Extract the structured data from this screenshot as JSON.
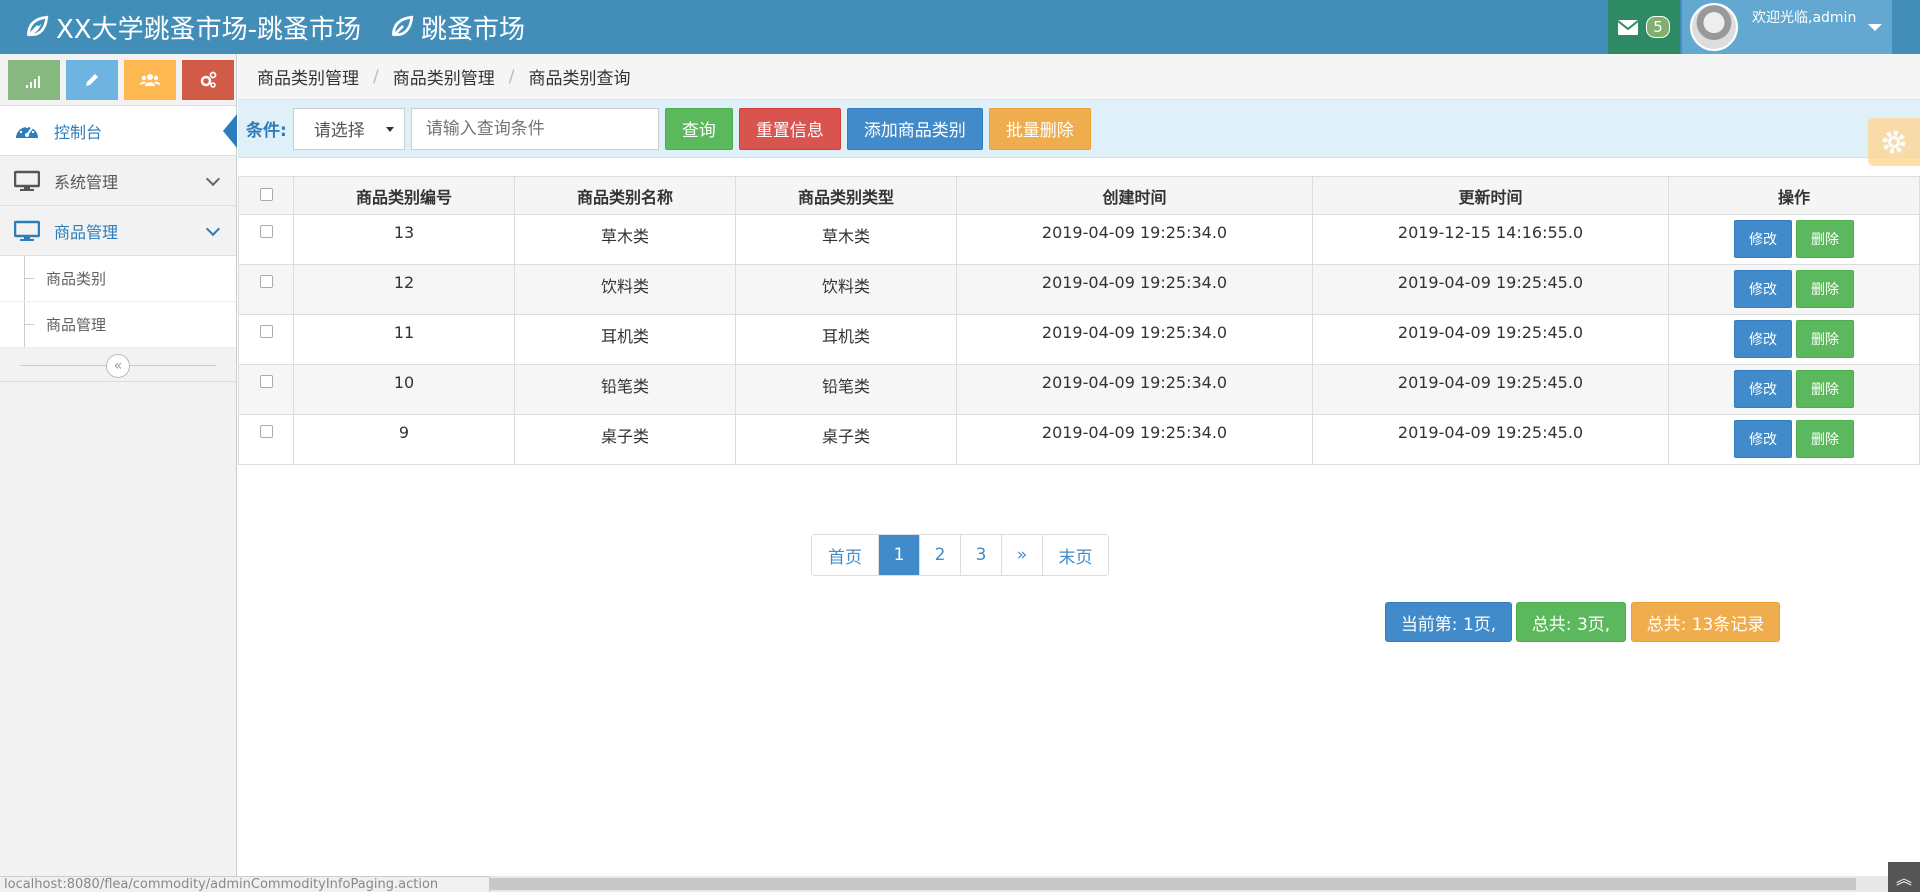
{
  "header": {
    "brand_title": "XX大学跳蚤市场-跳蚤市场",
    "brand_sub": "跳蚤市场",
    "message_count": "5",
    "welcome": "欢迎光临,admin",
    "accent": "#438eb9"
  },
  "sidebar": {
    "shortcuts": [
      {
        "icon": "signal-icon",
        "color": "#87b87f"
      },
      {
        "icon": "pencil-icon",
        "color": "#6fb3e0"
      },
      {
        "icon": "group-icon",
        "color": "#ffb752"
      },
      {
        "icon": "cogs-icon",
        "color": "#d15b47"
      }
    ],
    "items": [
      {
        "label": "控制台",
        "icon": "dashboard-icon"
      },
      {
        "label": "系统管理",
        "icon": "desktop-icon"
      },
      {
        "label": "商品管理",
        "icon": "desktop-icon"
      }
    ],
    "subitems": [
      {
        "label": "商品类别"
      },
      {
        "label": "商品管理"
      }
    ],
    "collapse_glyph": "«"
  },
  "breadcrumb": [
    "商品类别管理",
    "商品类别管理",
    "商品类别查询"
  ],
  "toolbar": {
    "condition_label": "条件:",
    "select_value": "请选择",
    "search_placeholder": "请输入查询条件",
    "query_label": "查询",
    "reset_label": "重置信息",
    "add_label": "添加商品类别",
    "batch_delete_label": "批量删除"
  },
  "table": {
    "headers": [
      "商品类别编号",
      "商品类别名称",
      "商品类别类型",
      "创建时间",
      "更新时间",
      "操作"
    ],
    "rows": [
      {
        "id": "13",
        "name": "草木类",
        "type": "草木类",
        "created": "2019-04-09 19:25:34.0",
        "updated": "2019-12-15 14:16:55.0"
      },
      {
        "id": "12",
        "name": "饮料类",
        "type": "饮料类",
        "created": "2019-04-09 19:25:34.0",
        "updated": "2019-04-09 19:25:45.0"
      },
      {
        "id": "11",
        "name": "耳机类",
        "type": "耳机类",
        "created": "2019-04-09 19:25:34.0",
        "updated": "2019-04-09 19:25:45.0"
      },
      {
        "id": "10",
        "name": "铅笔类",
        "type": "铅笔类",
        "created": "2019-04-09 19:25:34.0",
        "updated": "2019-04-09 19:25:45.0"
      },
      {
        "id": "9",
        "name": "桌子类",
        "type": "桌子类",
        "created": "2019-04-09 19:25:34.0",
        "updated": "2019-04-09 19:25:45.0"
      }
    ],
    "edit_label": "修改",
    "delete_label": "删除"
  },
  "pagination": {
    "first": "首页",
    "pages": [
      "1",
      "2",
      "3"
    ],
    "next": "»",
    "last": "末页",
    "current": "1"
  },
  "summary": {
    "current_page": "当前第: 1页,",
    "total_pages": "总共: 3页,",
    "total_records": "总共: 13条记录"
  },
  "statusbar": {
    "url": "localhost:8080/flea/commodity/adminCommodityInfoPaging.action"
  }
}
